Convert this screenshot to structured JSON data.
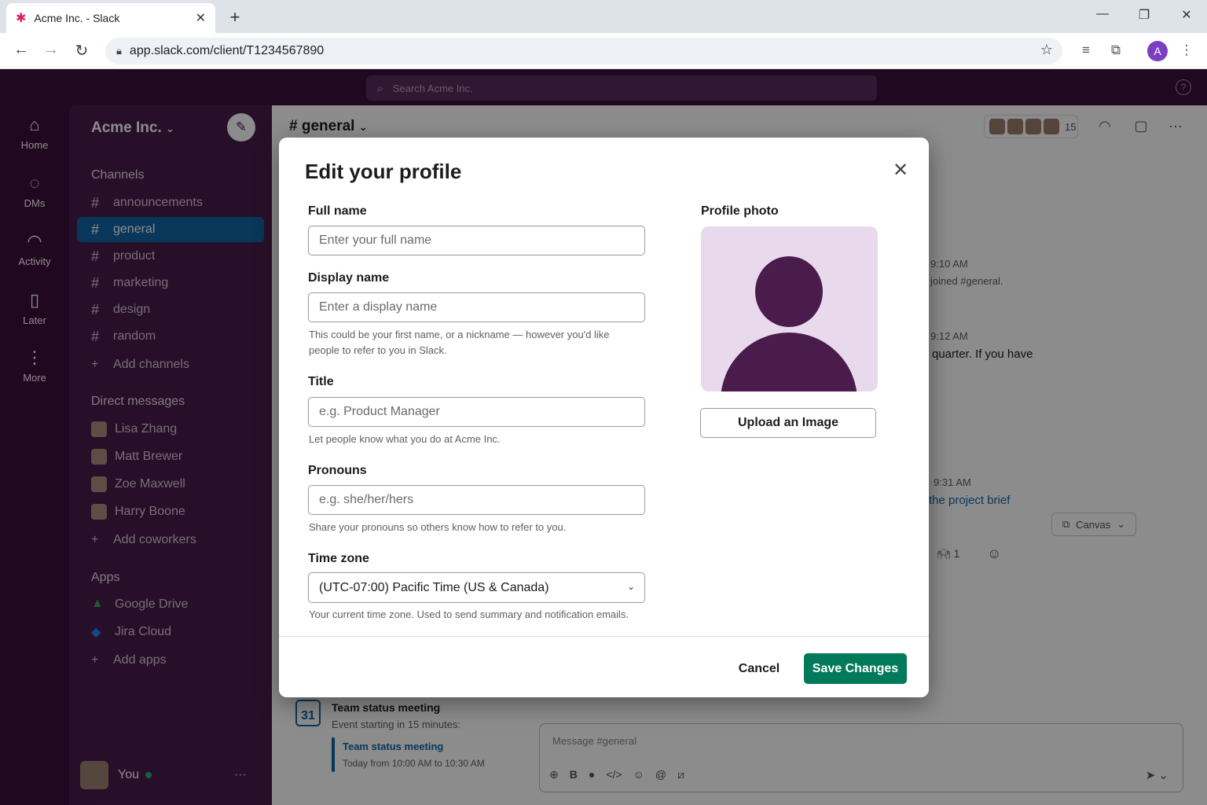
{
  "browser": {
    "tab_title": "Acme Inc. - Slack",
    "url": "app.slack.com/client/T1234567890",
    "profile_initial": "A"
  },
  "slack": {
    "search_placeholder": "Search Acme Inc.",
    "rail": [
      {
        "label": "Home",
        "icon": "home-icon"
      },
      {
        "label": "DMs",
        "icon": "dms-icon"
      },
      {
        "label": "Activity",
        "icon": "bell-icon"
      },
      {
        "label": "Later",
        "icon": "bookmark-icon"
      },
      {
        "label": "More",
        "icon": "more-icon"
      }
    ],
    "workspace": "Acme Inc.",
    "channels_header": "Channels",
    "channels": [
      "announcements",
      "general",
      "product",
      "marketing",
      "design",
      "random"
    ],
    "add_channels": "Add channels",
    "dm_header": "Direct messages",
    "dms": [
      "Lisa Zhang",
      "Matt Brewer",
      "Zoe Maxwell",
      "Harry Boone"
    ],
    "add_coworkers": "Add coworkers",
    "apps_header": "Apps",
    "apps": [
      "Google Drive",
      "Jira Cloud"
    ],
    "add_apps": "Add apps",
    "you_label": "You",
    "channel_name": "# general",
    "member_count": "15",
    "fragments": {
      "time1": "9:10 AM",
      "joined": "joined #general.",
      "time2": "9:12 AM",
      "quarter": "quarter. If you have",
      "time3": "9:31 AM",
      "brief": "the project brief",
      "canvas": "Canvas",
      "reaction_count": "1"
    },
    "event": {
      "cal_day": "31",
      "title": "Team status meeting",
      "subtitle": "Event starting in 15 minutes:",
      "link": "Team status meeting",
      "time": "Today from 10:00 AM to 10:30 AM"
    },
    "composer_placeholder": "Message #general"
  },
  "modal": {
    "title": "Edit your profile",
    "full_name": {
      "label": "Full name",
      "placeholder": "Enter your full name",
      "value": ""
    },
    "display_name": {
      "label": "Display name",
      "placeholder": "Enter a display name",
      "value": "",
      "help": "This could be your first name, or a nickname — however you'd like people to refer to you in Slack."
    },
    "title_field": {
      "label": "Title",
      "placeholder": "e.g. Product Manager",
      "value": "",
      "help": "Let people know what you do at Acme Inc."
    },
    "pronouns": {
      "label": "Pronouns",
      "placeholder": "e.g. she/her/hers",
      "value": "",
      "help": "Share your pronouns so others know how to refer to you."
    },
    "time_zone": {
      "label": "Time zone",
      "value": "(UTC-07:00) Pacific Time (US & Canada)",
      "help": "Your current time zone. Used to send summary and notification emails."
    },
    "photo_label": "Profile photo",
    "upload_label": "Upload an Image",
    "cancel_label": "Cancel",
    "save_label": "Save Changes",
    "accent_color": "#007a5a"
  }
}
